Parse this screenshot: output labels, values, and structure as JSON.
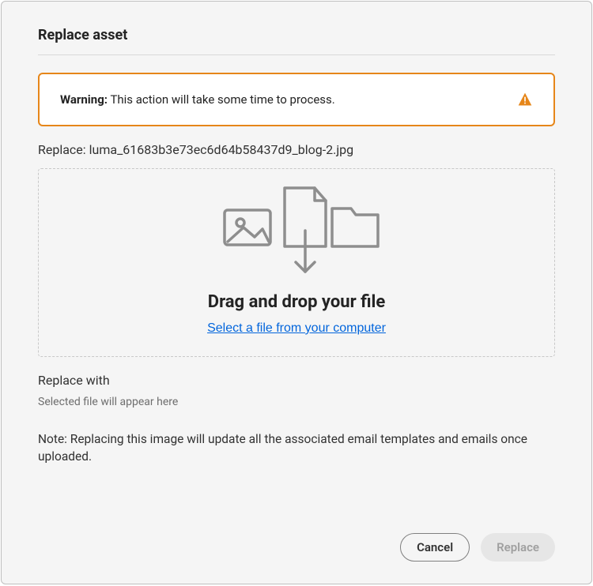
{
  "dialog": {
    "title": "Replace asset"
  },
  "warning": {
    "prefix": "Warning:",
    "message": "This action will take some time to process."
  },
  "replace": {
    "label_prefix": "Replace:",
    "filename": "luma_61683b3e73ec6d64b58437d9_blog-2.jpg"
  },
  "dropzone": {
    "title": "Drag and drop your file",
    "link_text": "Select a file from your computer"
  },
  "replace_with": {
    "label": "Replace with",
    "placeholder": "Selected file will appear here"
  },
  "note": {
    "text": "Note: Replacing this image will update all the associated email templates and emails once uploaded."
  },
  "actions": {
    "cancel": "Cancel",
    "replace": "Replace"
  },
  "colors": {
    "warning_border": "#e68619",
    "link": "#0265dc"
  }
}
